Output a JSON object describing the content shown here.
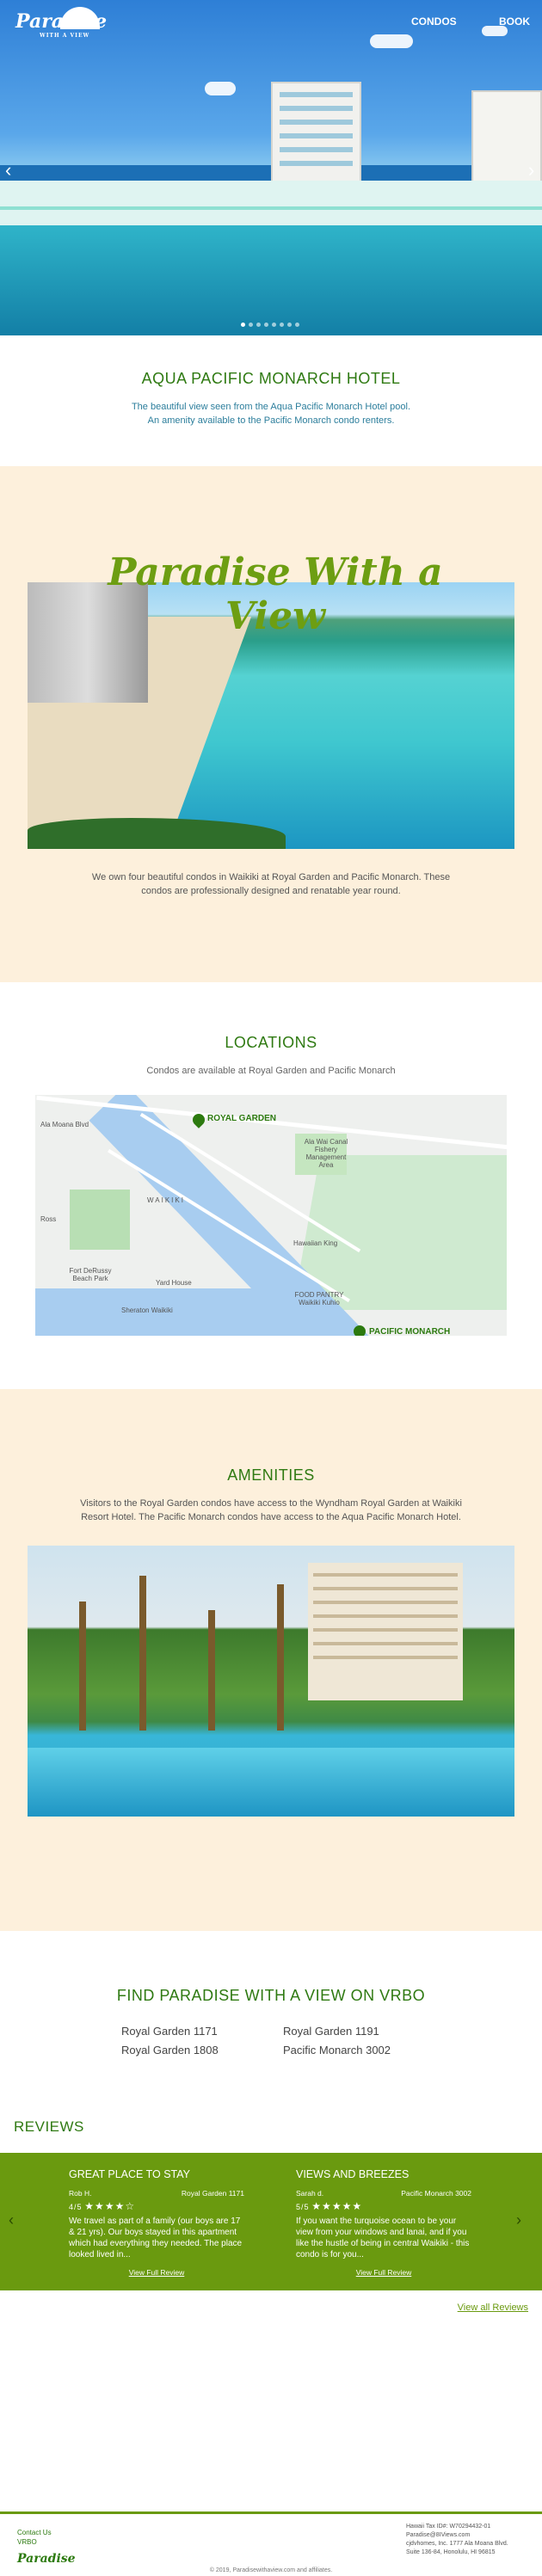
{
  "header": {
    "logo": "Paradise",
    "logo_tagline": "WITH A VIEW",
    "nav": [
      "CONDOS",
      "BOOK"
    ]
  },
  "intro": {
    "title": "AQUA PACIFIC MONARCH HOTEL",
    "line1": "The beautiful view seen from the Aqua Pacific Monarch Hotel pool.",
    "line2": "An amenity available to the Pacific Monarch condo renters."
  },
  "paradise": {
    "title": "Paradise With a View",
    "line1": "We own four beautiful condos in Waikiki at Royal Garden and Pacific Monarch. These",
    "line2": "condos are professionally designed and renatable year round."
  },
  "locations": {
    "title": "LOCATIONS",
    "subtitle": "Condos are available at Royal Garden and Pacific Monarch",
    "map": {
      "pin1": "ROYAL GARDEN",
      "pin2": "PACIFIC MONARCH",
      "labels": [
        "Ala Moana Blvd",
        "Ala Wai Canal Fishery Management Area",
        "WAIKIKI",
        "Hawaiian King",
        "FOOD PANTRY Waikiki Kuhio",
        "Fort DeRussy Beach Park",
        "Yard House",
        "Sheraton Waikiki",
        "Ross"
      ]
    }
  },
  "amenities": {
    "title": "AMENITIES",
    "line1": "Visitors to the Royal Garden condos have access to the Wyndham Royal Garden at Waikiki",
    "line2": "Resort Hotel. The Pacific Monarch condos have access to the Aqua Pacific Monarch Hotel."
  },
  "vrbo": {
    "title": "FIND PARADISE WITH A VIEW ON VRBO",
    "links": [
      "Royal Garden 1171",
      "Royal Garden 1191",
      "Royal Garden 1808",
      "Pacific Monarch 3002"
    ]
  },
  "reviews": {
    "title": "REVIEWS",
    "items": [
      {
        "heading": "GREAT PLACE TO STAY",
        "author": "Rob H.",
        "property": "Royal Garden 1171",
        "score": "4/5",
        "rating": 4,
        "stars": "★★★★☆",
        "text": "We travel as part of a family (our boys are 17 & 21 yrs). Our boys stayed in this apartment which had everything they needed. The place looked lived in...",
        "link": "View Full Review"
      },
      {
        "heading": "VIEWS AND BREEZES",
        "author": "Sarah d.",
        "property": "Pacific Monarch 3002",
        "score": "5/5",
        "rating": 5,
        "stars": "★★★★★",
        "text": "If you want the turquoise ocean to be your view from your windows and lanai, and if you like the hustle of being in central Waikiki - this condo is for you...",
        "link": "View Full Review"
      }
    ],
    "view_all": "View all Reviews"
  },
  "footer": {
    "contact": "Contact Us",
    "vrbo": "VRBO",
    "logo": "Paradise",
    "tax": "Hawaii Tax ID#: W70294432-01",
    "email": "Paradise@8IViews.com",
    "company": "cjdvhomes, Inc. 1777 Ala Moana Blvd.",
    "address": "Suite 136-84, Honolulu, HI 96815",
    "copyright": "© 2019, Paradisewithaview.com and affiliates."
  },
  "colors": {
    "green": "#6a9a0f",
    "dark_green": "#2f7a12",
    "cream": "#fdf0dc",
    "teal_text": "#2c7e9c"
  }
}
